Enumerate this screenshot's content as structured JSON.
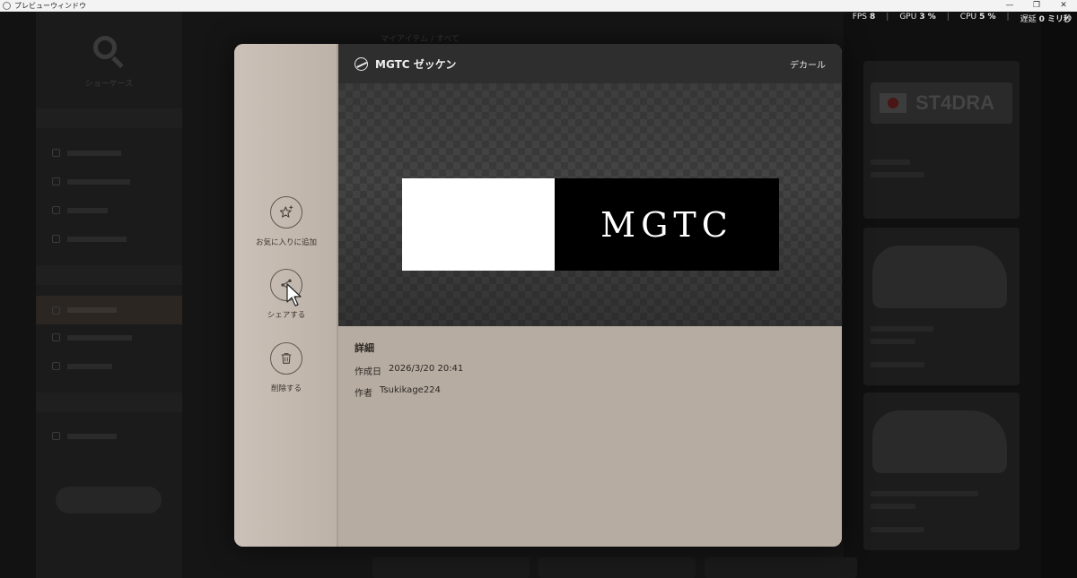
{
  "window": {
    "title": "プレビューウィンドウ",
    "controls": [
      "—",
      "❐",
      "✕"
    ]
  },
  "stats": [
    {
      "label": "FPS",
      "value": "8"
    },
    {
      "label": "GPU",
      "value": "3 %"
    },
    {
      "label": "CPU",
      "value": "5 %"
    },
    {
      "label": "遅延",
      "value": "0 ミリ秒"
    }
  ],
  "background": {
    "showcase_label": "ショーケース",
    "breadcrumb": "マイアイテム / すべて"
  },
  "modal": {
    "title": "MGTC ゼッケン",
    "category": "デカール",
    "decal_text": "MGTC",
    "actions": [
      {
        "label": "お気に入りに追加",
        "icon": "star-plus-icon"
      },
      {
        "label": "シェアする",
        "icon": "share-icon"
      },
      {
        "label": "削除する",
        "icon": "trash-icon"
      }
    ],
    "details": {
      "heading": "詳細",
      "created_label": "作成日",
      "created_value": "2026/3/20 20:41",
      "author_label": "作者",
      "author_value": "Tsukikage224"
    }
  },
  "right_cards": [
    {
      "plate_text": "ST4DRA"
    }
  ],
  "colors": {
    "modal_bg": "#b8aea4",
    "header_bg": "#2e2e2e",
    "decal_black": "#000000",
    "decal_white": "#ffffff"
  }
}
